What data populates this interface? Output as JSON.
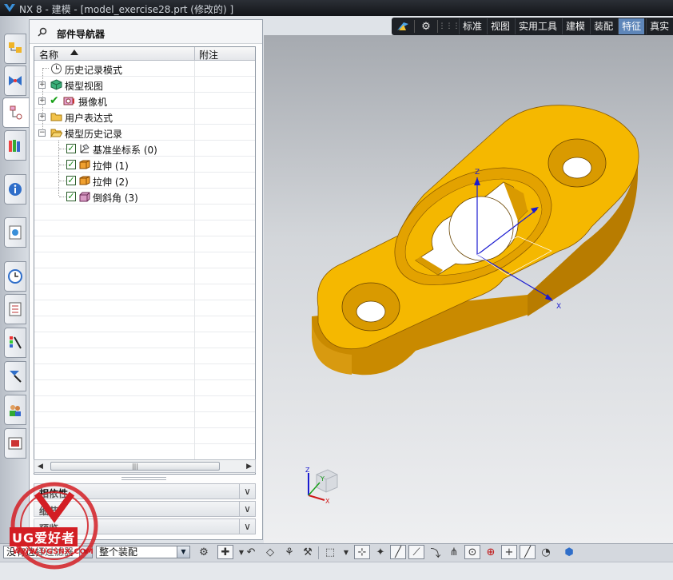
{
  "window": {
    "title": "NX 8 - 建模 - [model_exercise28.prt (修改的) ]"
  },
  "top_toolbar": {
    "tabs": [
      "标准",
      "视图",
      "实用工具",
      "建模",
      "装配",
      "特征",
      "真实"
    ],
    "active_tab": "特征"
  },
  "resource_bar": {
    "items": [
      "assembly-navigator",
      "constraint-navigator",
      "part-navigator",
      "reuse-library",
      "hd3d-tools",
      "web-browser",
      "history",
      "process-studio",
      "visualization-editor",
      "manufacturing-wizards",
      "roles",
      "system-scenes"
    ],
    "active": "part-navigator"
  },
  "navigator": {
    "title": "部件导航器",
    "columns": {
      "name": "名称",
      "note": "附注"
    },
    "rows": [
      {
        "label": "历史记录模式",
        "icon": "clock-icon"
      },
      {
        "label": "模型视图",
        "icon": "model-views-icon"
      },
      {
        "label": "摄像机",
        "icon": "camera-icon"
      },
      {
        "label": "用户表达式",
        "icon": "folder-icon"
      },
      {
        "label": "模型历史记录",
        "icon": "open-folder-icon"
      },
      {
        "label": "基准坐标系 (0)",
        "icon": "datum-csys-icon"
      },
      {
        "label": "拉伸 (1)",
        "icon": "extrude-icon"
      },
      {
        "label": "拉伸 (2)",
        "icon": "extrude-icon"
      },
      {
        "label": "倒斜角 (3)",
        "icon": "chamfer-icon"
      }
    ],
    "panels": [
      "相依性",
      "细节",
      "预览"
    ]
  },
  "graphics": {
    "csys_labels": {
      "x": "X",
      "y": "Y",
      "z": "Z"
    },
    "part_color": "#f5b800",
    "part_side_color": "#c98a00"
  },
  "bottom_toolbar": {
    "type_filter": "没有选择过滤器",
    "type_filter_prefix": "没有",
    "scope": "整个装配"
  },
  "watermark": {
    "text": "UG爱好者",
    "url": "WWW.UGSNX.COM"
  }
}
